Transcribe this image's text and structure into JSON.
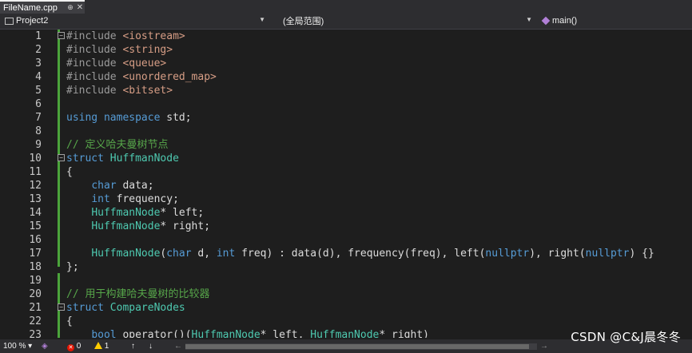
{
  "tab": {
    "filename": "FileName.cpp",
    "pin_glyph": "⊕",
    "close_glyph": "✕"
  },
  "navbar": {
    "project": "Project2",
    "scope": "(全局范围)",
    "member": "main()"
  },
  "lines": [
    {
      "n": "1",
      "tokens": [
        [
          "pp",
          "#include "
        ],
        [
          "str",
          "<iostream>"
        ]
      ],
      "fold": "⊟"
    },
    {
      "n": "2",
      "tokens": [
        [
          "pp",
          "#include "
        ],
        [
          "str",
          "<string>"
        ]
      ]
    },
    {
      "n": "3",
      "tokens": [
        [
          "pp",
          "#include "
        ],
        [
          "str",
          "<queue>"
        ]
      ]
    },
    {
      "n": "4",
      "tokens": [
        [
          "pp",
          "#include "
        ],
        [
          "str",
          "<unordered_map>"
        ]
      ]
    },
    {
      "n": "5",
      "tokens": [
        [
          "pp",
          "#include "
        ],
        [
          "str",
          "<bitset>"
        ]
      ]
    },
    {
      "n": "6",
      "tokens": []
    },
    {
      "n": "7",
      "tokens": [
        [
          "kw",
          "using"
        ],
        [
          "p",
          " "
        ],
        [
          "kw",
          "namespace"
        ],
        [
          "p",
          " std;"
        ]
      ]
    },
    {
      "n": "8",
      "tokens": []
    },
    {
      "n": "9",
      "tokens": [
        [
          "cm",
          "// 定义哈夫曼树节点"
        ]
      ]
    },
    {
      "n": "10",
      "tokens": [
        [
          "kw",
          "struct"
        ],
        [
          "p",
          " "
        ],
        [
          "ty",
          "HuffmanNode"
        ]
      ],
      "fold": "⊟"
    },
    {
      "n": "11",
      "tokens": [
        [
          "p",
          "{"
        ]
      ]
    },
    {
      "n": "12",
      "tokens": [
        [
          "p",
          "    "
        ],
        [
          "kw",
          "char"
        ],
        [
          "p",
          " data;"
        ]
      ]
    },
    {
      "n": "13",
      "tokens": [
        [
          "p",
          "    "
        ],
        [
          "kw",
          "int"
        ],
        [
          "p",
          " frequency;"
        ]
      ]
    },
    {
      "n": "14",
      "tokens": [
        [
          "p",
          "    "
        ],
        [
          "ty",
          "HuffmanNode"
        ],
        [
          "p",
          "* left;"
        ]
      ]
    },
    {
      "n": "15",
      "tokens": [
        [
          "p",
          "    "
        ],
        [
          "ty",
          "HuffmanNode"
        ],
        [
          "p",
          "* right;"
        ]
      ]
    },
    {
      "n": "16",
      "tokens": []
    },
    {
      "n": "17",
      "tokens": [
        [
          "p",
          "    "
        ],
        [
          "ty",
          "HuffmanNode"
        ],
        [
          "p",
          "("
        ],
        [
          "kw",
          "char"
        ],
        [
          "p",
          " d, "
        ],
        [
          "kw",
          "int"
        ],
        [
          "p",
          " freq) : data(d), frequency(freq), left("
        ],
        [
          "kw",
          "nullptr"
        ],
        [
          "p",
          "), right("
        ],
        [
          "kw",
          "nullptr"
        ],
        [
          "p",
          ") {}"
        ]
      ]
    },
    {
      "n": "18",
      "tokens": [
        [
          "p",
          "};"
        ]
      ]
    },
    {
      "n": "19",
      "tokens": []
    },
    {
      "n": "20",
      "tokens": [
        [
          "cm",
          "// 用于构建哈夫曼树的比较器"
        ]
      ]
    },
    {
      "n": "21",
      "tokens": [
        [
          "kw",
          "struct"
        ],
        [
          "p",
          " "
        ],
        [
          "ty",
          "CompareNodes"
        ]
      ],
      "fold": "⊟"
    },
    {
      "n": "22",
      "tokens": [
        [
          "p",
          "{"
        ]
      ]
    },
    {
      "n": "23",
      "tokens": [
        [
          "p",
          "    "
        ],
        [
          "kw",
          "bool"
        ],
        [
          "p",
          " operator()("
        ],
        [
          "ty",
          "HuffmanNode"
        ],
        [
          "p",
          "* left, "
        ],
        [
          "ty",
          "HuffmanNode"
        ],
        [
          "p",
          "* right)"
        ]
      ]
    }
  ],
  "status": {
    "zoom": "100 %",
    "errors": "0",
    "warnings": "1",
    "up_arrow": "↑",
    "down_arrow": "↓",
    "left_arrow": "←",
    "right_arrow": "→"
  },
  "watermark": "CSDN @C&J晨冬冬"
}
